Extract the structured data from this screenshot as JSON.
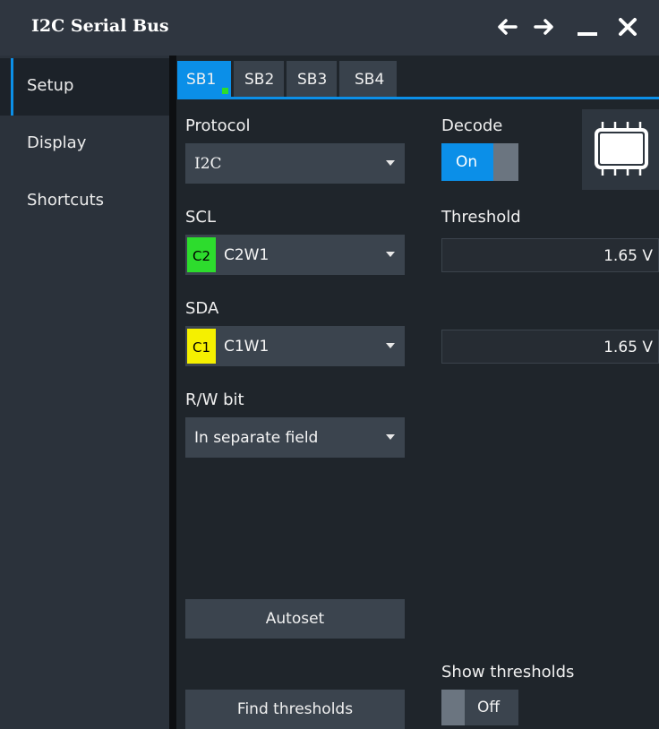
{
  "window": {
    "title": "I2C Serial Bus",
    "controls": [
      "arrow-left-icon",
      "arrow-right-icon",
      "minimize-icon",
      "close-icon"
    ]
  },
  "sidebar": {
    "items": [
      {
        "label": "Setup",
        "active": true
      },
      {
        "label": "Display",
        "active": false
      },
      {
        "label": "Shortcuts",
        "active": false
      }
    ]
  },
  "tabs": [
    {
      "label": "SB1",
      "active": true
    },
    {
      "label": "SB2",
      "active": false
    },
    {
      "label": "SB3",
      "active": false
    },
    {
      "label": "SB4",
      "active": false
    }
  ],
  "protocol": {
    "label": "Protocol",
    "value": "I2C"
  },
  "decode": {
    "label": "Decode",
    "state": "On"
  },
  "scl": {
    "label": "SCL",
    "chip": "C2",
    "chip_color": "#2ddc2d",
    "value": "C2W1"
  },
  "threshold": {
    "label": "Threshold",
    "scl_value": "1.65 V",
    "sda_value": "1.65 V"
  },
  "sda": {
    "label": "SDA",
    "chip": "C1",
    "chip_color": "#f5f000",
    "value": "C1W1"
  },
  "rw_bit": {
    "label": "R/W bit",
    "value": "In separate field"
  },
  "buttons": {
    "autoset": "Autoset",
    "find_thresholds": "Find thresholds"
  },
  "show_thresholds": {
    "label": "Show thresholds",
    "state": "Off"
  },
  "colors": {
    "accent": "#0b8fe8",
    "active_indicator": "#2ddc2d"
  }
}
